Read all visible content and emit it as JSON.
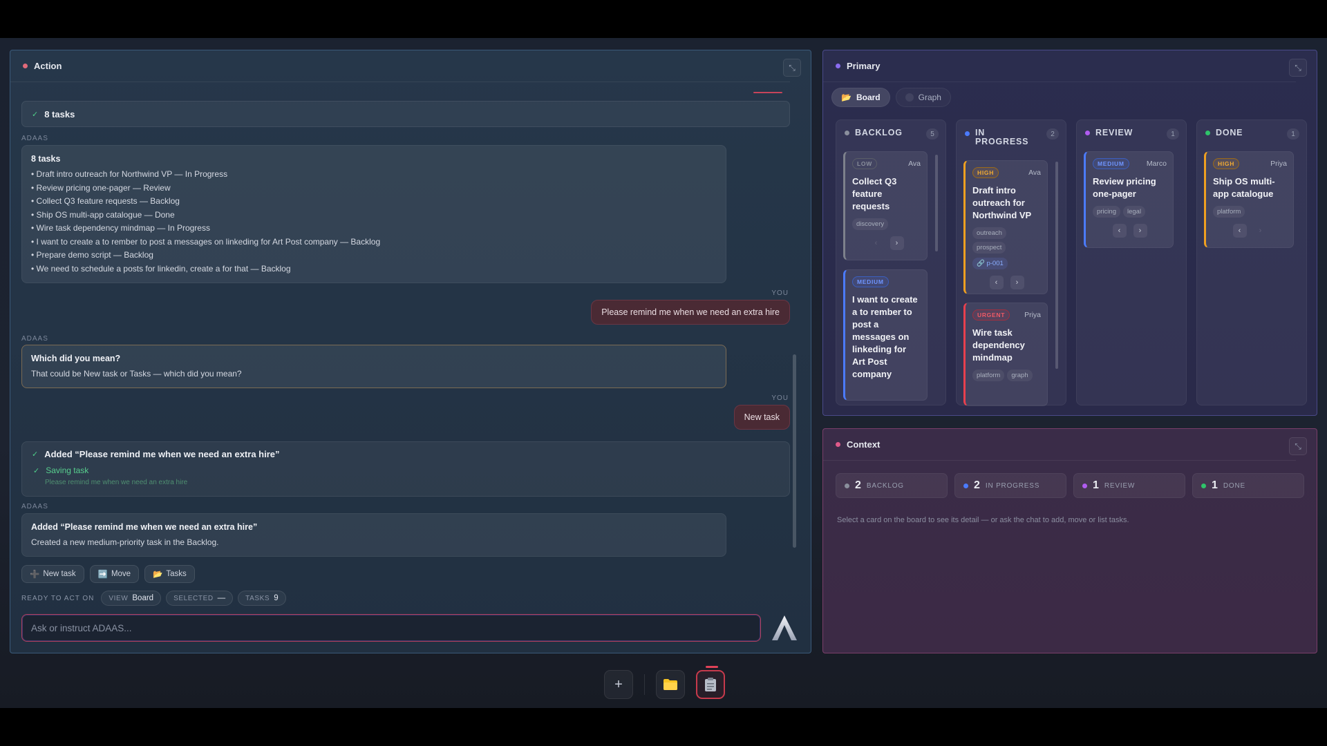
{
  "action": {
    "title": "Action",
    "dot_color": "#e06a7a",
    "tasks_bar": "8 tasks",
    "label_adaas": "ADAAS",
    "label_you": "YOU",
    "list_msg": {
      "title": "8 tasks",
      "lines": [
        "• Draft intro outreach for Northwind VP — In Progress",
        "• Review pricing one-pager — Review",
        "• Collect Q3 feature requests — Backlog",
        "• Ship OS multi-app catalogue — Done",
        "• Wire task dependency mindmap — In Progress",
        "• I want to create a to rember to post a messages on linkeding for Art Post company — Backlog",
        "• Prepare demo script — Backlog",
        "• We need to schedule a posts for linkedin, create a for that — Backlog"
      ]
    },
    "user_msg_1": "Please remind me when we need an extra hire",
    "clarify": {
      "title": "Which did you mean?",
      "body": "That could be New task or Tasks — which did you mean?"
    },
    "user_msg_2": "New task",
    "added_card": {
      "title": "Added “Please remind me when we need an extra hire”",
      "saving": "Saving task",
      "saving_sub": "Please remind me when we need an extra hire"
    },
    "added_msg": {
      "title": "Added “Please remind me when we need an extra hire”",
      "body": "Created a new medium-priority task in the Backlog."
    },
    "chips": [
      {
        "icon": "➕",
        "label": "New task"
      },
      {
        "icon": "➡️",
        "label": "Move"
      },
      {
        "icon": "📂",
        "label": "Tasks"
      }
    ],
    "status": {
      "ready": "READY TO ACT ON",
      "view_k": "VIEW",
      "view_v": "Board",
      "selected_k": "SELECTED",
      "selected_v": "—",
      "tasks_k": "TASKS",
      "tasks_v": "9"
    },
    "input_placeholder": "Ask or instruct ADAAS..."
  },
  "primary": {
    "title": "Primary",
    "dot_color": "#8a6cf0",
    "tabs": [
      {
        "icon": "📂",
        "label": "Board",
        "active": true
      },
      {
        "icon": "",
        "label": "Graph",
        "active": false
      }
    ],
    "columns": [
      {
        "title": "BACKLOG",
        "count": "5",
        "color": "#8a8f9c"
      },
      {
        "title": "IN PROGRESS",
        "count": "2",
        "color": "#4b7bff"
      },
      {
        "title": "REVIEW",
        "count": "1",
        "color": "#b05cf0"
      },
      {
        "title": "DONE",
        "count": "1",
        "color": "#2fc46a"
      }
    ],
    "cards": {
      "c1": {
        "prio": "LOW",
        "assignee": "Ava",
        "title": "Collect Q3 feature requests",
        "tags": [
          "discovery"
        ]
      },
      "c2": {
        "prio": "MEDIUM",
        "assignee": "",
        "title": "I want to create a to rember to post a messages on linkeding for Art Post company",
        "tags": []
      },
      "c3": {
        "prio": "HIGH",
        "assignee": "Ava",
        "title": "Draft intro outreach for Northwind VP",
        "tags": [
          "outreach",
          "prospect"
        ],
        "link": "🔗 p-001"
      },
      "c4": {
        "prio": "URGENT",
        "assignee": "Priya",
        "title": "Wire task dependency mindmap",
        "tags": [
          "platform",
          "graph"
        ]
      },
      "c5": {
        "prio": "MEDIUM",
        "assignee": "Marco",
        "title": "Review pricing one-pager",
        "tags": [
          "pricing",
          "legal"
        ]
      },
      "c6": {
        "prio": "HIGH",
        "assignee": "Priya",
        "title": "Ship OS multi-app catalogue",
        "tags": [
          "platform"
        ]
      }
    },
    "colors": {
      "low": "#8a8f9c",
      "medium": "#4b7bff",
      "high": "#f0a020",
      "urgent": "#e8404e"
    }
  },
  "context": {
    "title": "Context",
    "dot_color": "#e05a8a",
    "stats": [
      {
        "n": "2",
        "label": "BACKLOG",
        "color": "#8a8f9c"
      },
      {
        "n": "2",
        "label": "IN PROGRESS",
        "color": "#4b7bff"
      },
      {
        "n": "1",
        "label": "REVIEW",
        "color": "#b05cf0"
      },
      {
        "n": "1",
        "label": "DONE",
        "color": "#2fc46a"
      }
    ],
    "hint": "Select a card on the board to see its detail — or ask the chat to add, move or list tasks."
  },
  "dock": {
    "icons": [
      "plus-icon",
      "folder-icon",
      "clipboard-icon"
    ]
  }
}
